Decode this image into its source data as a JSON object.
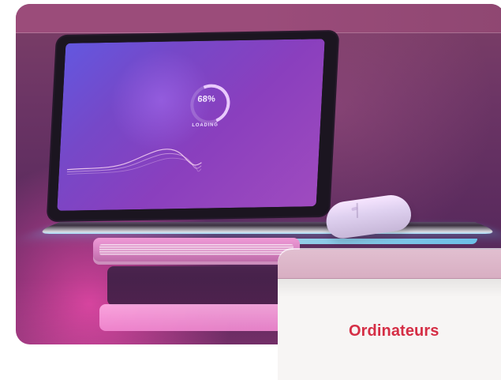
{
  "hero": {
    "screen": {
      "progress_text": "68%",
      "status_text": "LOADING"
    }
  },
  "category_card": {
    "title": "Ordinateurs"
  },
  "icons": {
    "mouse": "computer-mouse-icon"
  },
  "colors": {
    "accent": "#D52E45",
    "card_background": "#F7F5F4",
    "card_header": "#D8AEC2"
  }
}
